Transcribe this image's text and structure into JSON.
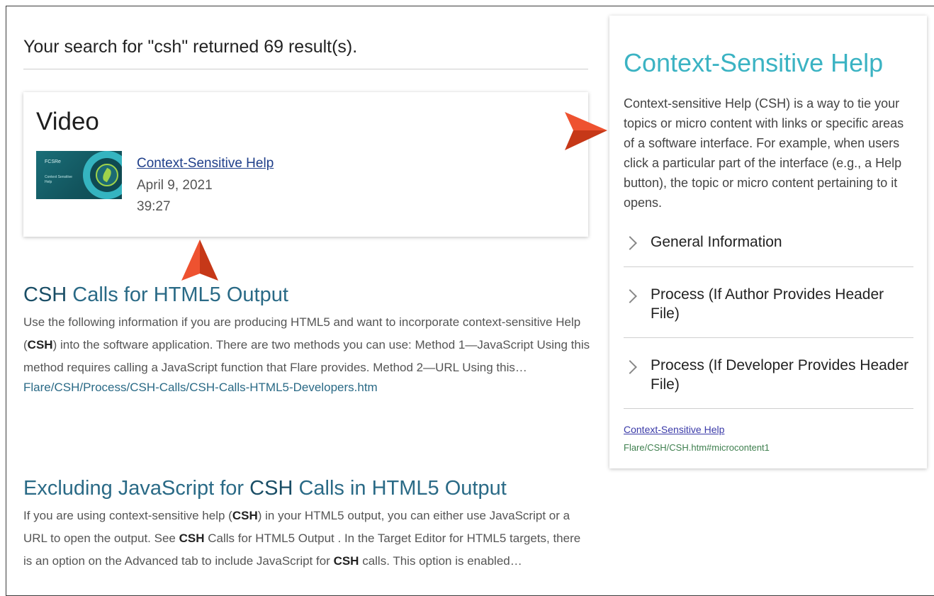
{
  "search": {
    "summary": "Your search for \"csh\" returned 69 result(s)."
  },
  "video": {
    "heading": "Video",
    "thumb_logo": "FCSRe",
    "thumb_subtitle": "Context Sensitive Help",
    "title": "Context-Sensitive Help",
    "date": "April 9, 2021",
    "duration": "39:27"
  },
  "results": [
    {
      "title_prefix": "",
      "title_highlight": "CSH",
      "title_suffix": " Calls for HTML5 Output",
      "snippet_parts": [
        "Use the following information if you are producing HTML5 and want to incorporate context-sensitive Help (",
        "CSH",
        ") into the software application. There are two methods you can use: Method 1—JavaScript Using this method requires calling a JavaScript function that Flare provides. Method 2—URL Using this…"
      ],
      "path": "Flare/CSH/Process/CSH-Calls/CSH-Calls-HTML5-Developers.htm"
    },
    {
      "title_prefix": "Excluding JavaScript for ",
      "title_highlight": "CSH",
      "title_suffix": " Calls in HTML5 Output",
      "snippet_parts": [
        "If you are using context-sensitive help (",
        "CSH",
        ") in your HTML5 output, you can either use JavaScript or a URL to open the output. See ",
        "CSH",
        " Calls for HTML5 Output . In the Target Editor for HTML5 targets, there is an option on the Advanced tab to include JavaScript for ",
        "CSH",
        " calls. This option is enabled…"
      ]
    }
  ],
  "panel": {
    "title": "Context-Sensitive Help",
    "description": "Context-sensitive Help (CSH) is a way to tie your topics or micro content with links or specific areas of a software interface. For example, when users click a particular part of the interface (e.g., a Help button), the topic or micro content pertaining to it opens.",
    "accordion": [
      {
        "label": "General Information"
      },
      {
        "label": "Process (If Author Provides Header File)"
      },
      {
        "label": "Process (If Developer Provides Header File)"
      }
    ],
    "link": "Context-Sensitive Help",
    "link_path": "Flare/CSH/CSH.htm#microcontent1"
  },
  "colors": {
    "accent": "#3bb3c3",
    "result_title": "#2a6a86",
    "callout_arrow": "#e8452a"
  },
  "icons": {
    "accordion": "chevron-right-icon",
    "callout": "callout-arrow-icon"
  }
}
